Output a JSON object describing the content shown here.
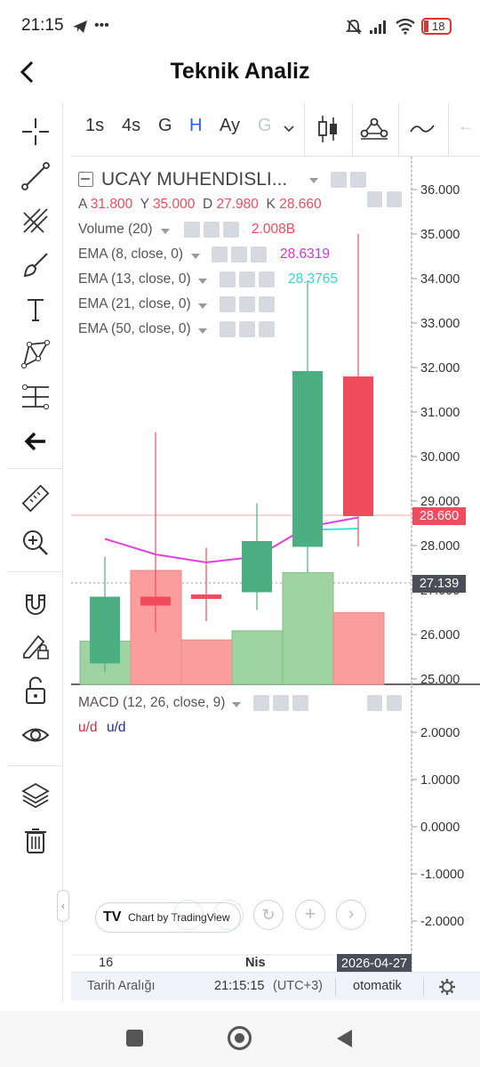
{
  "status_bar": {
    "time": "21:15",
    "battery": "18"
  },
  "header": {
    "title": "Teknik Analiz"
  },
  "toolbar": {
    "intervals": [
      "1s",
      "4s",
      "G",
      "H",
      "Ay",
      "G"
    ],
    "active_interval": "H"
  },
  "legend": {
    "symbol": "UCAY MUHENDISLI...",
    "ohlc": {
      "a_label": "A",
      "a": "31.800",
      "y_label": "Y",
      "y": "35.000",
      "d_label": "D",
      "d": "27.980",
      "k_label": "K",
      "k": "28.660"
    },
    "volume": {
      "label": "Volume (20)",
      "value": "2.008B"
    },
    "ema8": {
      "label": "EMA (8, close, 0)",
      "value": "28.6319"
    },
    "ema13": {
      "label": "EMA (13, close, 0)",
      "value": "28.3765"
    },
    "ema21": {
      "label": "EMA (21, close, 0)",
      "value": ""
    },
    "ema50": {
      "label": "EMA (50, close, 0)",
      "value": ""
    }
  },
  "price_axis": {
    "ticks": [
      "36.000",
      "35.000",
      "34.000",
      "33.000",
      "32.000",
      "31.000",
      "30.000",
      "29.000",
      "28.000",
      "27.000",
      "26.000",
      "25.000"
    ],
    "last_price": "28.660",
    "crosshair_price": "27.139"
  },
  "macd_pane": {
    "label": "MACD (12, 26, close, 9)",
    "legend_1": "u/d",
    "legend_2": "u/d",
    "ticks": [
      "2.0000",
      "1.0000",
      "0.0000",
      "-1.0000",
      "-2.0000"
    ]
  },
  "time_axis": {
    "labels": [
      "16",
      "Nis"
    ],
    "crosshair_date": "2026-04-27"
  },
  "watermark": "Chart by TradingView",
  "bottom_bar": {
    "range_label": "Tarih Aralığı",
    "time": "21:15:15",
    "timezone": "(UTC+3)",
    "mode": "otomatik"
  },
  "colors": {
    "up": "#4caf82",
    "down": "#ef4c5e",
    "ema8": "#e040e0",
    "ema13": "#40e0e0",
    "accent": "#2962ff"
  },
  "chart_data": {
    "type": "candlestick",
    "candles": [
      {
        "o": 25.35,
        "h": 27.75,
        "l": 25.15,
        "c": 26.85,
        "vol_rel": 0.38
      },
      {
        "o": 26.85,
        "h": 30.55,
        "l": 26.05,
        "c": 26.65,
        "vol_rel": 1.0
      },
      {
        "o": 26.9,
        "h": 27.95,
        "l": 26.3,
        "c": 26.8,
        "vol_rel": 0.39
      },
      {
        "o": 26.95,
        "h": 28.95,
        "l": 26.55,
        "c": 28.1,
        "vol_rel": 0.47
      },
      {
        "o": 27.97,
        "h": 33.95,
        "l": 27.4,
        "c": 31.92,
        "vol_rel": 0.98
      },
      {
        "o": 31.8,
        "h": 35.0,
        "l": 27.98,
        "c": 28.66,
        "vol_rel": 0.63
      }
    ],
    "ema8": [
      28.15,
      27.8,
      27.62,
      27.75,
      28.42,
      28.63
    ],
    "ema13": [
      null,
      null,
      null,
      null,
      28.35,
      28.38
    ],
    "ylim": [
      25.0,
      36.0
    ]
  }
}
